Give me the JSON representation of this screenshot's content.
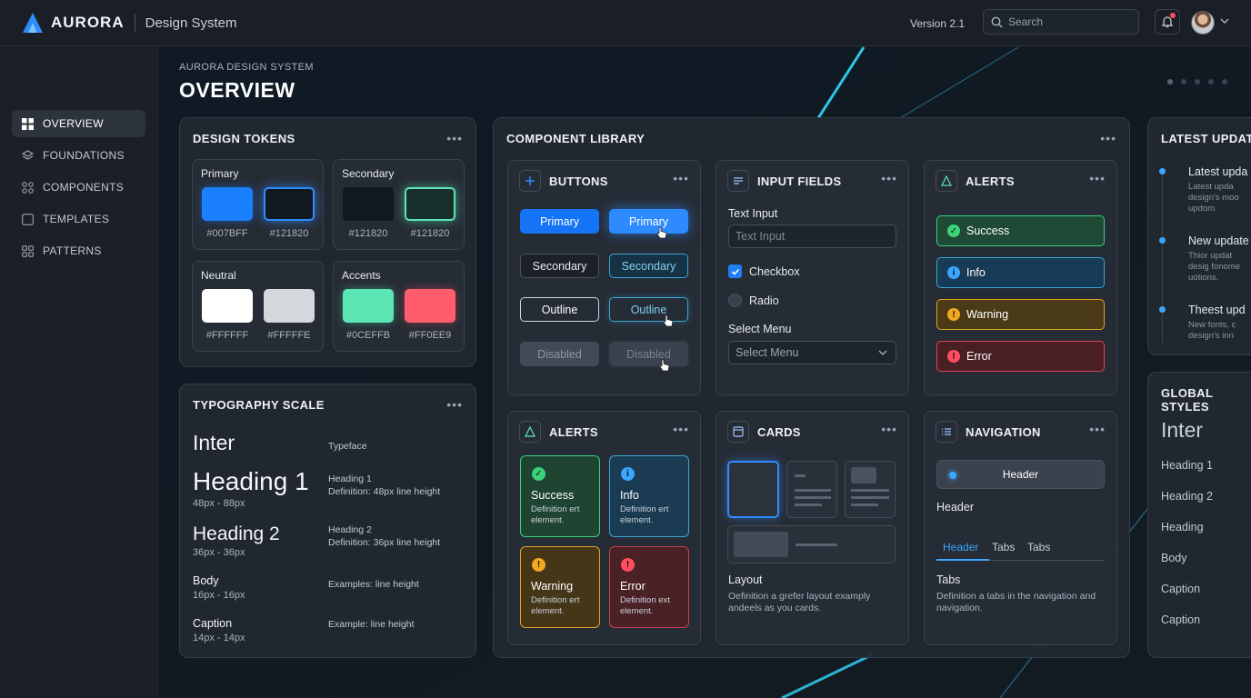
{
  "app": {
    "brand": "AURORA",
    "subtitle": "Design System",
    "version": "Version 2.1"
  },
  "search": {
    "placeholder": "Search"
  },
  "sidebar": {
    "items": [
      {
        "label": "OVERVIEW",
        "icon": "grid-icon",
        "active": true
      },
      {
        "label": "FOUNDATIONS",
        "icon": "layers-icon"
      },
      {
        "label": "COMPONENTS",
        "icon": "components-icon"
      },
      {
        "label": "TEMPLATES",
        "icon": "template-icon"
      },
      {
        "label": "PATTERNS",
        "icon": "patterns-icon"
      }
    ]
  },
  "page": {
    "eyebrow": "AURORA DESIGN SYSTEM",
    "title": "OVERVIEW"
  },
  "tokens": {
    "title": "DESIGN TOKENS",
    "groups": [
      {
        "name": "Primary",
        "swatches": [
          {
            "hex": "#007BFF",
            "color": "#1a80ff"
          },
          {
            "hex": "#121820",
            "color": "#121820"
          }
        ]
      },
      {
        "name": "Secondary",
        "swatches": [
          {
            "hex": "#121820",
            "color": "#121820"
          },
          {
            "hex": "#121820",
            "color": "#17302c"
          }
        ]
      },
      {
        "name": "Neutral",
        "swatches": [
          {
            "hex": "#FFFFFF",
            "color": "#ffffff"
          },
          {
            "hex": "#FFFFFE",
            "color": "#d4d7dc"
          }
        ]
      },
      {
        "name": "Accents",
        "swatches": [
          {
            "hex": "#0CEFFB",
            "color": "#5be6b4"
          },
          {
            "hex": "#FF0EE9",
            "color": "#ff5d6c"
          }
        ]
      }
    ]
  },
  "typography": {
    "title": "TYPOGRAPHY SCALE",
    "rows": [
      {
        "name": "Inter",
        "sub": "",
        "right1": "Typeface",
        "right2": ""
      },
      {
        "name": "Heading 1",
        "sub": "48px - 88px",
        "right1": "Heading 1",
        "right2": "Definition: 48px  line height"
      },
      {
        "name": "Heading 2",
        "sub": "36px - 36px",
        "right1": "Heading 2",
        "right2": "Definition: 36px  line height"
      },
      {
        "name": "Body",
        "sub": "16px - 16px",
        "right1": "Examples: line height",
        "right2": ""
      },
      {
        "name": "Caption",
        "sub": "14px - 14px",
        "right1": "Example: line height",
        "right2": ""
      }
    ]
  },
  "library": {
    "title": "COMPONENT LIBRARY",
    "buttons": {
      "title": "BUTTONS",
      "rows": [
        [
          "Primary",
          "Primary"
        ],
        [
          "Secondary",
          "Secondary"
        ],
        [
          "Outline",
          "Outline"
        ],
        [
          "Disabled",
          "Disabled"
        ]
      ]
    },
    "inputs": {
      "title": "INPUT FIELDS",
      "text_label": "Text Input",
      "text_placeholder": "Text Input",
      "checkbox": "Checkbox",
      "radio": "Radio",
      "select_label": "Select Menu",
      "select_value": "Select Menu"
    },
    "alerts": {
      "title": "ALERTS",
      "items": [
        "Success",
        "Info",
        "Warning",
        "Error"
      ]
    },
    "alert_tiles": {
      "title": "ALERTS",
      "tiles": [
        {
          "title": "Success",
          "desc": "Definition ert element."
        },
        {
          "title": "Info",
          "desc": "Definition ert element."
        },
        {
          "title": "Warning",
          "desc": "Definition ert element."
        },
        {
          "title": "Error",
          "desc": "Definition ext element."
        }
      ]
    },
    "cards": {
      "title": "CARDS",
      "label": "Layout",
      "desc": "Oefinition a grefer layout examply andeels as you cards."
    },
    "navigation": {
      "title": "NAVIGATION",
      "pill": "Header",
      "header": "Header",
      "tabs": [
        "Header",
        "Tabs",
        "Tabs"
      ],
      "label": "Tabs",
      "desc": "Definition a tabs in the navigation and navigation."
    }
  },
  "updates": {
    "title": "LATEST UPDATE",
    "items": [
      {
        "title": "Latest upda",
        "desc": [
          "Latest upda",
          "design's moo",
          "updom."
        ]
      },
      {
        "title": "New update",
        "desc": [
          "Thior updat",
          "desig fonome",
          "uotions."
        ]
      },
      {
        "title": "Theest upd",
        "desc": [
          "New fonts, c",
          "design's inn"
        ]
      }
    ]
  },
  "global": {
    "title": "GLOBAL STYLES",
    "face": "Inter",
    "items": [
      "Heading 1",
      "Heading 2",
      "Heading",
      "Body",
      "Caption",
      "Caption"
    ]
  }
}
